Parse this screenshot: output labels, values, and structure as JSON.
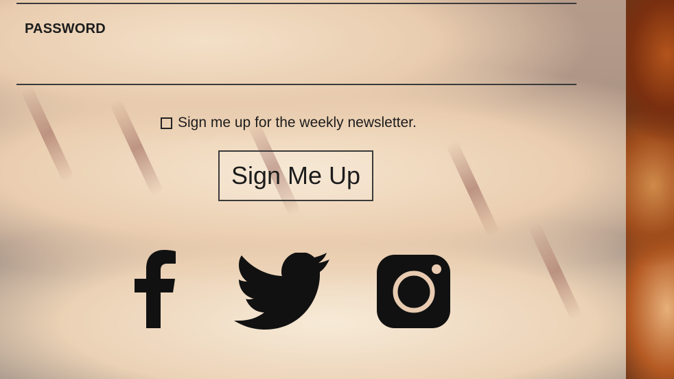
{
  "form": {
    "password_label": "PASSWORD",
    "newsletter_label": "Sign me up for the weekly newsletter.",
    "newsletter_checked": false,
    "submit_label": "Sign Me Up"
  },
  "social": [
    {
      "name": "facebook",
      "icon": "facebook-icon"
    },
    {
      "name": "twitter",
      "icon": "twitter-icon"
    },
    {
      "name": "instagram",
      "icon": "instagram-icon"
    }
  ],
  "colors": {
    "text": "#1c1c1c",
    "line": "#3a3a3a",
    "icon": "#111111"
  }
}
